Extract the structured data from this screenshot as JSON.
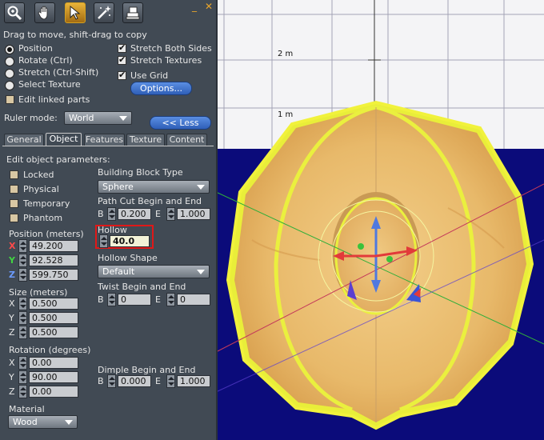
{
  "scene": {
    "ruler_labels": [
      "2 m",
      "1 m"
    ]
  },
  "toolbar": {
    "tools": [
      {
        "name": "focus",
        "icon": "magnifier-icon"
      },
      {
        "name": "move",
        "icon": "grab-hand-icon"
      },
      {
        "name": "edit",
        "icon": "pointer-icon"
      },
      {
        "name": "create",
        "icon": "magic-wand-icon"
      },
      {
        "name": "land",
        "icon": "bulldozer-icon"
      }
    ],
    "minimize": "_",
    "close": "✕"
  },
  "hint": "Drag to move, shift-drag to copy",
  "modes": [
    {
      "label": "Position",
      "checked": true
    },
    {
      "label": "Rotate (Ctrl)",
      "checked": false
    },
    {
      "label": "Stretch (Ctrl-Shift)",
      "checked": false
    },
    {
      "label": "Select Texture",
      "checked": false
    }
  ],
  "options": {
    "stretch_both_sides": "Stretch Both Sides",
    "stretch_textures": "Stretch Textures",
    "use_grid": "Use Grid",
    "options_button": "Options...",
    "edit_linked": "Edit linked parts"
  },
  "ruler": {
    "label": "Ruler mode:",
    "value": "World",
    "less_button": "<< Less"
  },
  "tabs": [
    "General",
    "Object",
    "Features",
    "Texture",
    "Content"
  ],
  "object": {
    "heading": "Edit object parameters:",
    "locked": "Locked",
    "physical": "Physical",
    "temporary": "Temporary",
    "phantom": "Phantom",
    "position_label": "Position (meters)",
    "position": {
      "x": "49.200",
      "y": "92.528",
      "z": "599.750"
    },
    "size_label": "Size (meters)",
    "size": {
      "x": "0.500",
      "y": "0.500",
      "z": "0.500"
    },
    "rotation_label": "Rotation (degrees)",
    "rotation": {
      "x": "0.00",
      "y": "90.00",
      "z": "0.00"
    },
    "material_label": "Material",
    "material": "Wood",
    "axis": {
      "x": "X",
      "y": "Y",
      "z": "Z"
    },
    "building_block_label": "Building Block Type",
    "building_block": "Sphere",
    "path_cut_label": "Path Cut Begin and End",
    "path_cut": {
      "b_label": "B",
      "b": "0.200",
      "e_label": "E",
      "e": "1.000"
    },
    "hollow_label": "Hollow",
    "hollow": "40.0",
    "hollow_shape_label": "Hollow Shape",
    "hollow_shape": "Default",
    "twist_label": "Twist Begin and End",
    "twist": {
      "b_label": "B",
      "b": "0",
      "e_label": "E",
      "e": "0"
    },
    "dimple_label": "Dimple Begin and End",
    "dimple": {
      "b_label": "B",
      "b": "0.000",
      "e_label": "E",
      "e": "1.000"
    }
  },
  "colors": {
    "panel": "#414a54",
    "tool_selected": "#e9b43a",
    "highlight": "#e01818",
    "axis_x": "#e23a3a",
    "axis_y": "#3bc23b",
    "axis_z": "#5b8de6"
  }
}
